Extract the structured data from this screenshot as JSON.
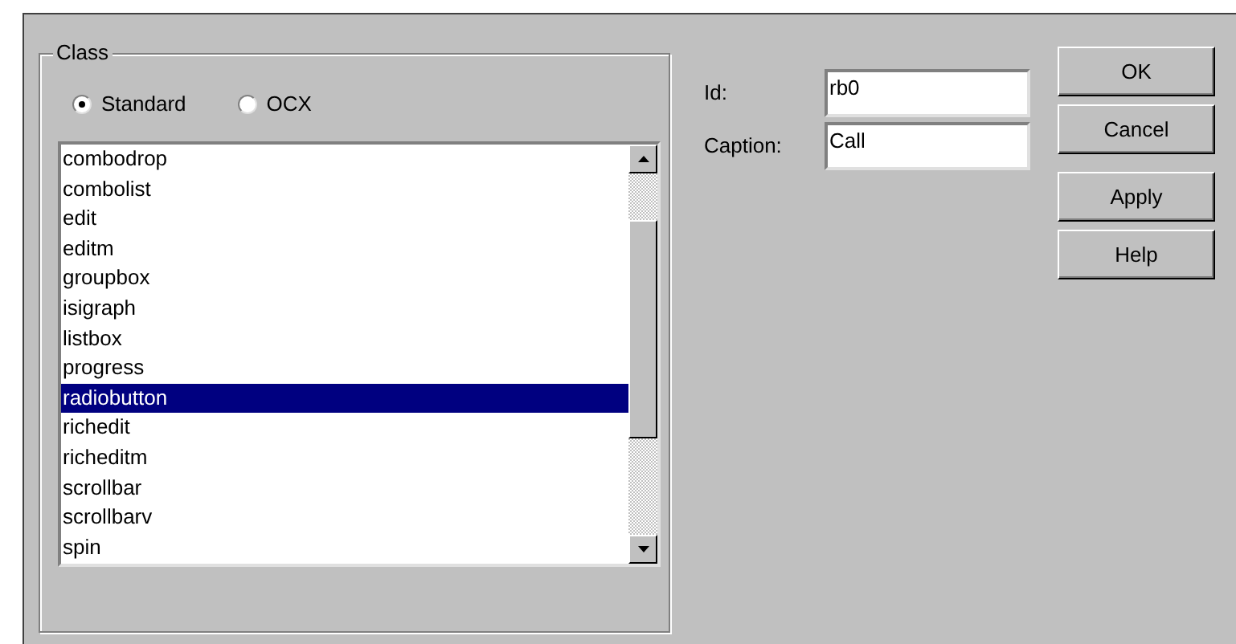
{
  "group_box": {
    "title": "Class"
  },
  "radios": [
    {
      "label": "Standard",
      "selected": true
    },
    {
      "label": "OCX",
      "selected": false
    }
  ],
  "class_list": {
    "items": [
      {
        "label": "combodrop",
        "selected": false
      },
      {
        "label": "combolist",
        "selected": false
      },
      {
        "label": "edit",
        "selected": false
      },
      {
        "label": "editm",
        "selected": false
      },
      {
        "label": "groupbox",
        "selected": false
      },
      {
        "label": "isigraph",
        "selected": false
      },
      {
        "label": "listbox",
        "selected": false
      },
      {
        "label": "progress",
        "selected": false
      },
      {
        "label": "radiobutton",
        "selected": true
      },
      {
        "label": "richedit",
        "selected": false
      },
      {
        "label": "richeditm",
        "selected": false
      },
      {
        "label": "scrollbar",
        "selected": false
      },
      {
        "label": "scrollbarv",
        "selected": false
      },
      {
        "label": "spin",
        "selected": false
      }
    ]
  },
  "fields": [
    {
      "label": "Id:",
      "value": "rb0"
    },
    {
      "label": "Caption:",
      "value": "Call"
    }
  ],
  "buttons": [
    "OK",
    "Cancel",
    "Apply",
    "Help"
  ]
}
